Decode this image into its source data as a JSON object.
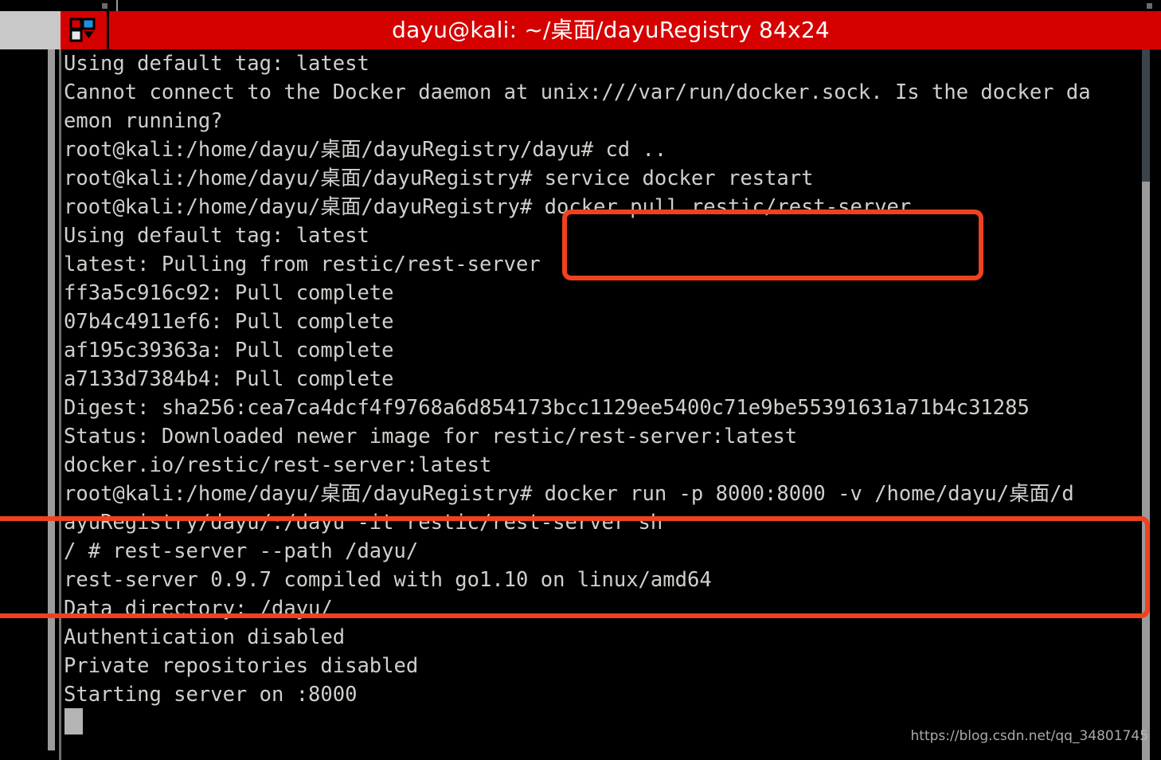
{
  "window": {
    "title": "dayu@kali: ~/桌面/dayuRegistry 84x24",
    "icon": "terminal-window-icon",
    "titlebar_color": "#d50000",
    "titlebar_text_color": "#ffffff"
  },
  "terminal": {
    "background": "#000000",
    "foreground": "#d0cfcc",
    "cursor": "block-cursor",
    "lines": [
      "Using default tag: latest",
      "Cannot connect to the Docker daemon at unix:///var/run/docker.sock. Is the docker da",
      "emon running?",
      "root@kali:/home/dayu/桌面/dayuRegistry/dayu# cd ..",
      "root@kali:/home/dayu/桌面/dayuRegistry# service docker restart",
      "root@kali:/home/dayu/桌面/dayuRegistry# docker pull restic/rest-server",
      "Using default tag: latest",
      "latest: Pulling from restic/rest-server",
      "ff3a5c916c92: Pull complete",
      "07b4c4911ef6: Pull complete",
      "af195c39363a: Pull complete",
      "a7133d7384b4: Pull complete",
      "Digest: sha256:cea7ca4dcf4f9768a6d854173bcc1129ee5400c71e9be55391631a71b4c31285",
      "Status: Downloaded newer image for restic/rest-server:latest",
      "docker.io/restic/rest-server:latest",
      "root@kali:/home/dayu/桌面/dayuRegistry# docker run -p 8000:8000 -v /home/dayu/桌面/d",
      "ayuRegistry/dayu/:/dayu -it restic/rest-server sh",
      "/ # rest-server --path /dayu/",
      "rest-server 0.9.7 compiled with go1.10 on linux/amd64",
      "Data directory: /dayu/",
      "Authentication disabled",
      "Private repositories disabled",
      "Starting server on :8000"
    ]
  },
  "annotations": {
    "color": "#f0411f",
    "box_1": {
      "label": "highlight-commands-pull",
      "contents": [
        "service docker restart",
        "docker pull restic/rest-server"
      ]
    },
    "box_2": {
      "label": "highlight-commands-run",
      "contents": [
        "root@kali:/home/dayu/桌面/dayuRegistry# docker run -p 8000:8000 -v /home/dayu/桌面/dayuRegistry/dayu/:/dayu -it restic/rest-server sh",
        "/ # rest-server --path /dayu/"
      ]
    }
  },
  "scrollbars": {
    "left_scrollbar": "left-scrollbar",
    "right_scrollbar": "right-scrollbar"
  },
  "watermark": {
    "text": "https://blog.csdn.net/qq_34801745"
  }
}
